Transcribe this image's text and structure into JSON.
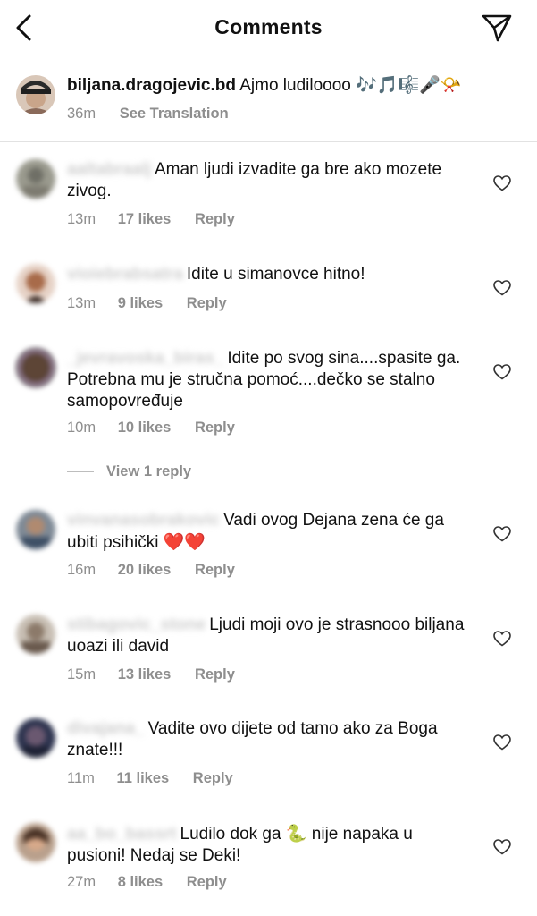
{
  "header": {
    "title": "Comments",
    "back_icon": "chevron-left-icon",
    "share_icon": "paper-plane-icon"
  },
  "post": {
    "username": "biljana.dragojevic.bd",
    "caption": "Ajmo ludiloooo",
    "caption_emojis": "🎶🎵🎼🎤📯",
    "time": "36m",
    "translate_label": "See Translation"
  },
  "comments": [
    {
      "user": "aaltabraalj",
      "text": "Aman ljudi izvadite ga bre ako mozete zivog.",
      "time": "13m",
      "likes": "17 likes",
      "reply": "Reply"
    },
    {
      "user": "vioiebrabsatra",
      "text": "Idite u simanovce hitno!",
      "time": "13m",
      "likes": "9 likes",
      "reply": "Reply"
    },
    {
      "user": "_jevravoska_biras_",
      "text": "Idite po svog sina....spasite ga. Potrebna mu je stručna pomoć....dečko se stalno samopovređuje",
      "time": "10m",
      "likes": "10 likes",
      "reply": "Reply"
    },
    {
      "user": "vinvanasobrakovic",
      "text": "Vadi ovog Dejana zena će ga ubiti psihički",
      "emoji": "❤️❤️",
      "time": "16m",
      "likes": "20 likes",
      "reply": "Reply"
    },
    {
      "user": "stibagovic_stone",
      "text": "Ljudi moji ovo je strasnooo biljana uoazi ili david",
      "time": "15m",
      "likes": "13 likes",
      "reply": "Reply"
    },
    {
      "user": "divajana_",
      "text": "Vadite ovo dijete od tamo ako za Boga znate!!!",
      "time": "11m",
      "likes": "11 likes",
      "reply": "Reply"
    },
    {
      "user": "aa_bo_bassrt",
      "text_before": "Ludilo dok ga",
      "emoji_mid": "🐍",
      "text_after": "nije napaka u pusioni!  Nedaj se Deki!",
      "time": "27m",
      "likes": "8 likes",
      "reply": "Reply"
    }
  ],
  "view_replies_label": "View 1 reply",
  "colors": {
    "text": "#111111",
    "meta": "#8e8e8e",
    "divider": "#e2e2e2",
    "heart": "#e02424"
  }
}
